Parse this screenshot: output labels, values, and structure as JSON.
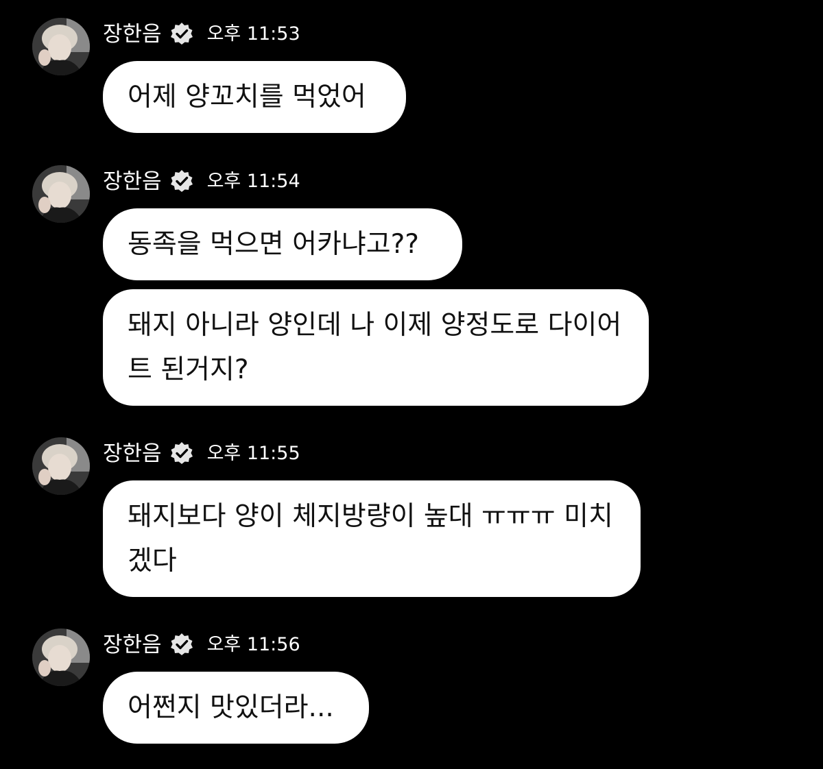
{
  "sender": {
    "name": "장한음",
    "avatar_icon": "user-avatar-photo",
    "verified_icon": "verified-badge-icon"
  },
  "messages": [
    {
      "time": "오후 11:53",
      "bubbles": [
        "어제 양꼬치를 먹었어"
      ]
    },
    {
      "time": "오후 11:54",
      "bubbles": [
        "동족을 먹으면 어카냐고??",
        "돼지 아니라 양인데 나 이제 양정도로 다이어트 된거지?"
      ]
    },
    {
      "time": "오후 11:55",
      "bubbles": [
        "돼지보다 양이 체지방량이 높대 ㅠㅠㅠ 미치겠다"
      ]
    },
    {
      "time": "오후 11:56",
      "bubbles": [
        "어쩐지 맛있더라..."
      ]
    }
  ],
  "colors": {
    "background": "#000000",
    "bubble": "#ffffff",
    "bubble_text": "#111111",
    "header_text": "#ffffff"
  }
}
